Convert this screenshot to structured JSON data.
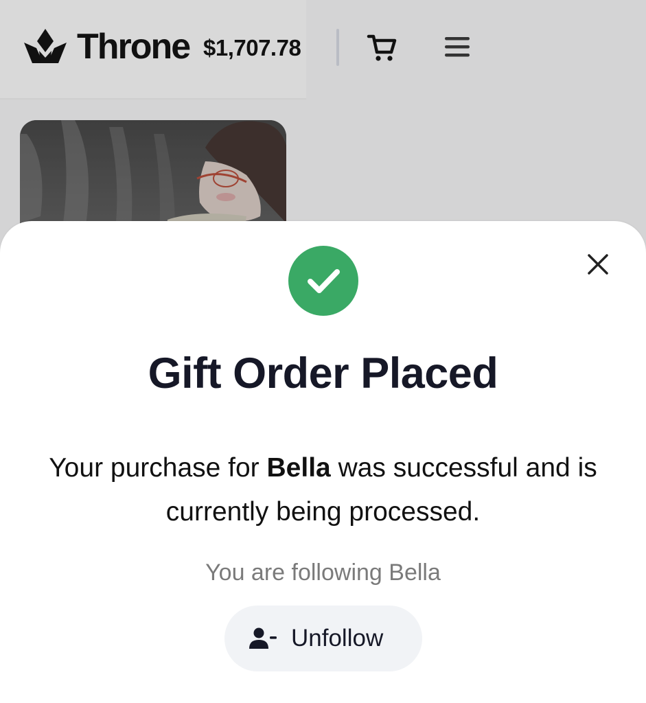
{
  "header": {
    "brand": "Throne",
    "balance": "$1,707.78",
    "logo_icon": "crown-icon",
    "cart_icon": "cart-icon",
    "menu_icon": "hamburger-menu-icon"
  },
  "background": {
    "card_image": "anime-character-artwork"
  },
  "modal": {
    "success_icon": "check-circle-icon",
    "close_icon": "close-icon",
    "title": "Gift Order Placed",
    "message_prefix": "Your purchase for ",
    "recipient": "Bella",
    "message_suffix": " was successful and is currently being processed.",
    "follow_status": "You are following Bella",
    "unfollow_label": "Unfollow",
    "unfollow_icon": "user-minus-icon",
    "success_color": "#3aa965"
  }
}
